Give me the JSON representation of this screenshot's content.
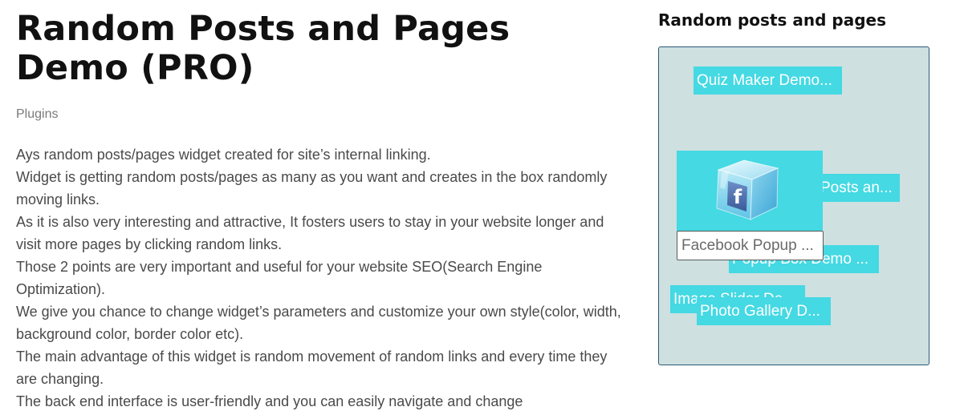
{
  "article": {
    "title": "Random Posts and Pages Demo (PRO)",
    "category": "Plugins",
    "paragraphs": [
      "Ays random posts/pages widget created for site’s internal linking.",
      "Widget is getting random posts/pages as many as you want and creates in the box randomly moving links.",
      "As it is also very interesting and attractive, It fosters users to stay in your website longer and visit more pages by clicking random links.",
      "Those 2 points are very important and useful for your website SEO(Search Engine Optimization).",
      "We give you chance to change widget’s parameters and customize your own style(color, width, background color, border color etc).",
      "The main advantage of this widget is random movement of random links and every time they are changing.",
      "The back end interface is user-friendly and you can easily navigate and change"
    ]
  },
  "sidebar": {
    "widget_title": "Random posts and pages",
    "links": [
      {
        "label": "Quiz Maker Demo..."
      },
      {
        "label": "Posts an..."
      },
      {
        "label": "Popup Box Demo ..."
      },
      {
        "label": "Image Slider De..."
      },
      {
        "label": "Photo Gallery D..."
      }
    ],
    "hover_card": {
      "label": "Facebook Popup ...",
      "icon": "facebook-ice-cube-icon"
    }
  },
  "colors": {
    "link_background": "#44d9e3",
    "box_background": "#cfe0e0",
    "box_border": "#2a5a78",
    "facebook_blue": "#3b5998"
  }
}
